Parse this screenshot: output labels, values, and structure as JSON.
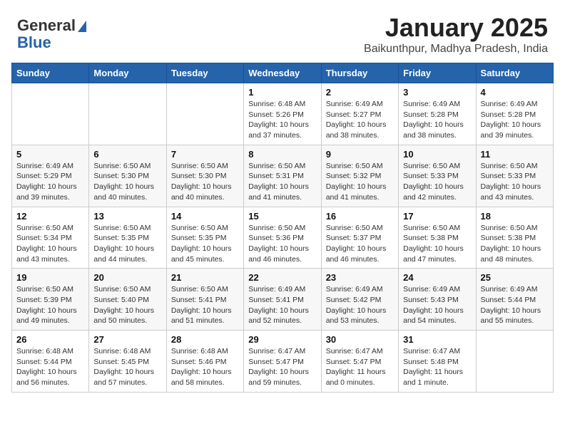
{
  "header": {
    "logo_general": "General",
    "logo_blue": "Blue",
    "month": "January 2025",
    "location": "Baikunthpur, Madhya Pradesh, India"
  },
  "weekdays": [
    "Sunday",
    "Monday",
    "Tuesday",
    "Wednesday",
    "Thursday",
    "Friday",
    "Saturday"
  ],
  "weeks": [
    [
      {
        "day": "",
        "sunrise": "",
        "sunset": "",
        "daylight": ""
      },
      {
        "day": "",
        "sunrise": "",
        "sunset": "",
        "daylight": ""
      },
      {
        "day": "",
        "sunrise": "",
        "sunset": "",
        "daylight": ""
      },
      {
        "day": "1",
        "sunrise": "Sunrise: 6:48 AM",
        "sunset": "Sunset: 5:26 PM",
        "daylight": "Daylight: 10 hours and 37 minutes."
      },
      {
        "day": "2",
        "sunrise": "Sunrise: 6:49 AM",
        "sunset": "Sunset: 5:27 PM",
        "daylight": "Daylight: 10 hours and 38 minutes."
      },
      {
        "day": "3",
        "sunrise": "Sunrise: 6:49 AM",
        "sunset": "Sunset: 5:28 PM",
        "daylight": "Daylight: 10 hours and 38 minutes."
      },
      {
        "day": "4",
        "sunrise": "Sunrise: 6:49 AM",
        "sunset": "Sunset: 5:28 PM",
        "daylight": "Daylight: 10 hours and 39 minutes."
      }
    ],
    [
      {
        "day": "5",
        "sunrise": "Sunrise: 6:49 AM",
        "sunset": "Sunset: 5:29 PM",
        "daylight": "Daylight: 10 hours and 39 minutes."
      },
      {
        "day": "6",
        "sunrise": "Sunrise: 6:50 AM",
        "sunset": "Sunset: 5:30 PM",
        "daylight": "Daylight: 10 hours and 40 minutes."
      },
      {
        "day": "7",
        "sunrise": "Sunrise: 6:50 AM",
        "sunset": "Sunset: 5:30 PM",
        "daylight": "Daylight: 10 hours and 40 minutes."
      },
      {
        "day": "8",
        "sunrise": "Sunrise: 6:50 AM",
        "sunset": "Sunset: 5:31 PM",
        "daylight": "Daylight: 10 hours and 41 minutes."
      },
      {
        "day": "9",
        "sunrise": "Sunrise: 6:50 AM",
        "sunset": "Sunset: 5:32 PM",
        "daylight": "Daylight: 10 hours and 41 minutes."
      },
      {
        "day": "10",
        "sunrise": "Sunrise: 6:50 AM",
        "sunset": "Sunset: 5:33 PM",
        "daylight": "Daylight: 10 hours and 42 minutes."
      },
      {
        "day": "11",
        "sunrise": "Sunrise: 6:50 AM",
        "sunset": "Sunset: 5:33 PM",
        "daylight": "Daylight: 10 hours and 43 minutes."
      }
    ],
    [
      {
        "day": "12",
        "sunrise": "Sunrise: 6:50 AM",
        "sunset": "Sunset: 5:34 PM",
        "daylight": "Daylight: 10 hours and 43 minutes."
      },
      {
        "day": "13",
        "sunrise": "Sunrise: 6:50 AM",
        "sunset": "Sunset: 5:35 PM",
        "daylight": "Daylight: 10 hours and 44 minutes."
      },
      {
        "day": "14",
        "sunrise": "Sunrise: 6:50 AM",
        "sunset": "Sunset: 5:35 PM",
        "daylight": "Daylight: 10 hours and 45 minutes."
      },
      {
        "day": "15",
        "sunrise": "Sunrise: 6:50 AM",
        "sunset": "Sunset: 5:36 PM",
        "daylight": "Daylight: 10 hours and 46 minutes."
      },
      {
        "day": "16",
        "sunrise": "Sunrise: 6:50 AM",
        "sunset": "Sunset: 5:37 PM",
        "daylight": "Daylight: 10 hours and 46 minutes."
      },
      {
        "day": "17",
        "sunrise": "Sunrise: 6:50 AM",
        "sunset": "Sunset: 5:38 PM",
        "daylight": "Daylight: 10 hours and 47 minutes."
      },
      {
        "day": "18",
        "sunrise": "Sunrise: 6:50 AM",
        "sunset": "Sunset: 5:38 PM",
        "daylight": "Daylight: 10 hours and 48 minutes."
      }
    ],
    [
      {
        "day": "19",
        "sunrise": "Sunrise: 6:50 AM",
        "sunset": "Sunset: 5:39 PM",
        "daylight": "Daylight: 10 hours and 49 minutes."
      },
      {
        "day": "20",
        "sunrise": "Sunrise: 6:50 AM",
        "sunset": "Sunset: 5:40 PM",
        "daylight": "Daylight: 10 hours and 50 minutes."
      },
      {
        "day": "21",
        "sunrise": "Sunrise: 6:50 AM",
        "sunset": "Sunset: 5:41 PM",
        "daylight": "Daylight: 10 hours and 51 minutes."
      },
      {
        "day": "22",
        "sunrise": "Sunrise: 6:49 AM",
        "sunset": "Sunset: 5:41 PM",
        "daylight": "Daylight: 10 hours and 52 minutes."
      },
      {
        "day": "23",
        "sunrise": "Sunrise: 6:49 AM",
        "sunset": "Sunset: 5:42 PM",
        "daylight": "Daylight: 10 hours and 53 minutes."
      },
      {
        "day": "24",
        "sunrise": "Sunrise: 6:49 AM",
        "sunset": "Sunset: 5:43 PM",
        "daylight": "Daylight: 10 hours and 54 minutes."
      },
      {
        "day": "25",
        "sunrise": "Sunrise: 6:49 AM",
        "sunset": "Sunset: 5:44 PM",
        "daylight": "Daylight: 10 hours and 55 minutes."
      }
    ],
    [
      {
        "day": "26",
        "sunrise": "Sunrise: 6:48 AM",
        "sunset": "Sunset: 5:44 PM",
        "daylight": "Daylight: 10 hours and 56 minutes."
      },
      {
        "day": "27",
        "sunrise": "Sunrise: 6:48 AM",
        "sunset": "Sunset: 5:45 PM",
        "daylight": "Daylight: 10 hours and 57 minutes."
      },
      {
        "day": "28",
        "sunrise": "Sunrise: 6:48 AM",
        "sunset": "Sunset: 5:46 PM",
        "daylight": "Daylight: 10 hours and 58 minutes."
      },
      {
        "day": "29",
        "sunrise": "Sunrise: 6:47 AM",
        "sunset": "Sunset: 5:47 PM",
        "daylight": "Daylight: 10 hours and 59 minutes."
      },
      {
        "day": "30",
        "sunrise": "Sunrise: 6:47 AM",
        "sunset": "Sunset: 5:47 PM",
        "daylight": "Daylight: 11 hours and 0 minutes."
      },
      {
        "day": "31",
        "sunrise": "Sunrise: 6:47 AM",
        "sunset": "Sunset: 5:48 PM",
        "daylight": "Daylight: 11 hours and 1 minute."
      },
      {
        "day": "",
        "sunrise": "",
        "sunset": "",
        "daylight": ""
      }
    ]
  ]
}
